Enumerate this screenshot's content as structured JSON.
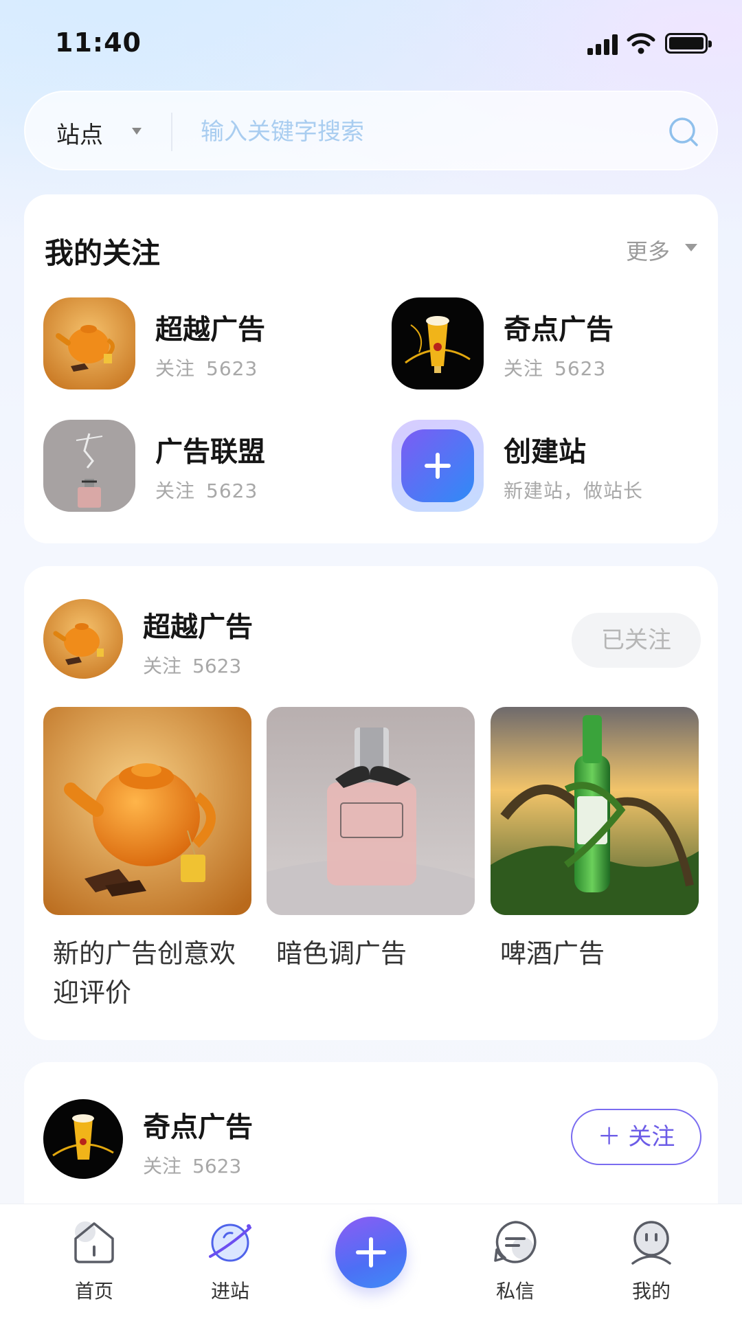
{
  "status_bar": {
    "time": "11:40"
  },
  "search": {
    "site_label": "站点",
    "placeholder": "输入关键字搜索"
  },
  "my_follows": {
    "title": "我的关注",
    "more_label": "更多",
    "items": [
      {
        "name": "超越广告",
        "follow_label": "关注",
        "count": "5623",
        "thumb": "orange-teapot"
      },
      {
        "name": "奇点广告",
        "follow_label": "关注",
        "count": "5623",
        "thumb": "beer-glass"
      },
      {
        "name": "广告联盟",
        "follow_label": "关注",
        "count": "5623",
        "thumb": "perfume-dancer"
      },
      {
        "name": "创建站",
        "sub": "新建站，做站长",
        "thumb": "plus-icon"
      }
    ]
  },
  "feed": [
    {
      "station": "超越广告",
      "follow_label": "关注",
      "count": "5623",
      "button_label": "已关注",
      "posts": [
        {
          "caption": "新的广告创意欢迎评价",
          "image": "orange-teapot"
        },
        {
          "caption": "暗色调广告",
          "image": "perfume-bottle"
        },
        {
          "caption": "啤酒广告",
          "image": "bulmers-bottle"
        }
      ]
    },
    {
      "station": "奇点广告",
      "follow_label": "关注",
      "count": "5623",
      "button_label": "＋ 关注"
    }
  ],
  "tabbar": {
    "items": [
      {
        "label": "首页",
        "icon": "home-icon"
      },
      {
        "label": "进站",
        "icon": "planet-icon"
      },
      {
        "label": "",
        "icon": "add-icon"
      },
      {
        "label": "私信",
        "icon": "message-icon"
      },
      {
        "label": "我的",
        "icon": "profile-icon"
      }
    ]
  },
  "colors": {
    "accent": "#5b5cf0",
    "accent_blue": "#3f8cf6",
    "placeholder": "#a9cdf0"
  }
}
